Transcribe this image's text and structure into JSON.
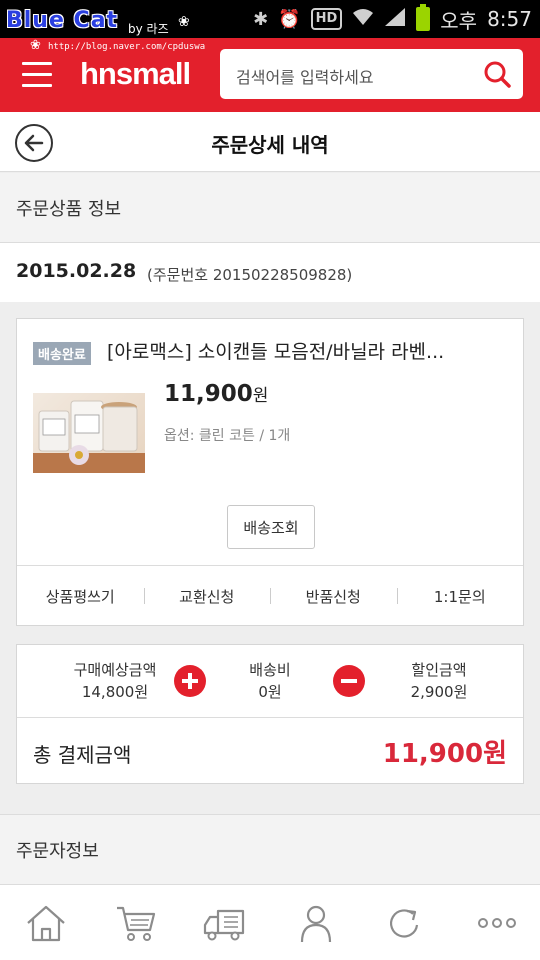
{
  "status_bar": {
    "watermark_title": "Blue Cat",
    "watermark_by": "by 라즈",
    "watermark_url": "http://blog.naver.com/cpduswa",
    "hd_label": "HD",
    "ampm": "오후",
    "time": "8:57"
  },
  "header": {
    "logo": "hnsmall",
    "search_placeholder": "검색어를 입력하세요",
    "brand_color": "#e3202c"
  },
  "title_bar": {
    "title": "주문상세 내역"
  },
  "product_section": {
    "label": "주문상품 정보"
  },
  "order": {
    "date": "2015.02.28",
    "number_text": "(주문번호 20150228509828)"
  },
  "item": {
    "status_badge": "배송완료",
    "name": "[아로맥스] 소이캔들 모음전/바닐라 라벤...",
    "price": "11,900",
    "price_unit": "원",
    "option": "옵션: 클린 코튼 / 1개",
    "track_button": "배송조회",
    "actions": [
      "상품평쓰기",
      "교환신청",
      "반품신청",
      "1:1문의"
    ]
  },
  "summary": {
    "expected_label": "구매예상금액",
    "expected_value": "14,800원",
    "shipping_label": "배송비",
    "shipping_value": "0원",
    "discount_label": "할인금액",
    "discount_value": "2,900원",
    "total_label": "총 결제금액",
    "total_value": "11,900원",
    "total_color": "#d9283a"
  },
  "orderer_section": {
    "label": "주문자정보"
  },
  "bottom_nav": {
    "icons": [
      "home-icon",
      "cart-icon",
      "truck-icon",
      "person-icon",
      "refresh-icon",
      "more-icon"
    ]
  }
}
